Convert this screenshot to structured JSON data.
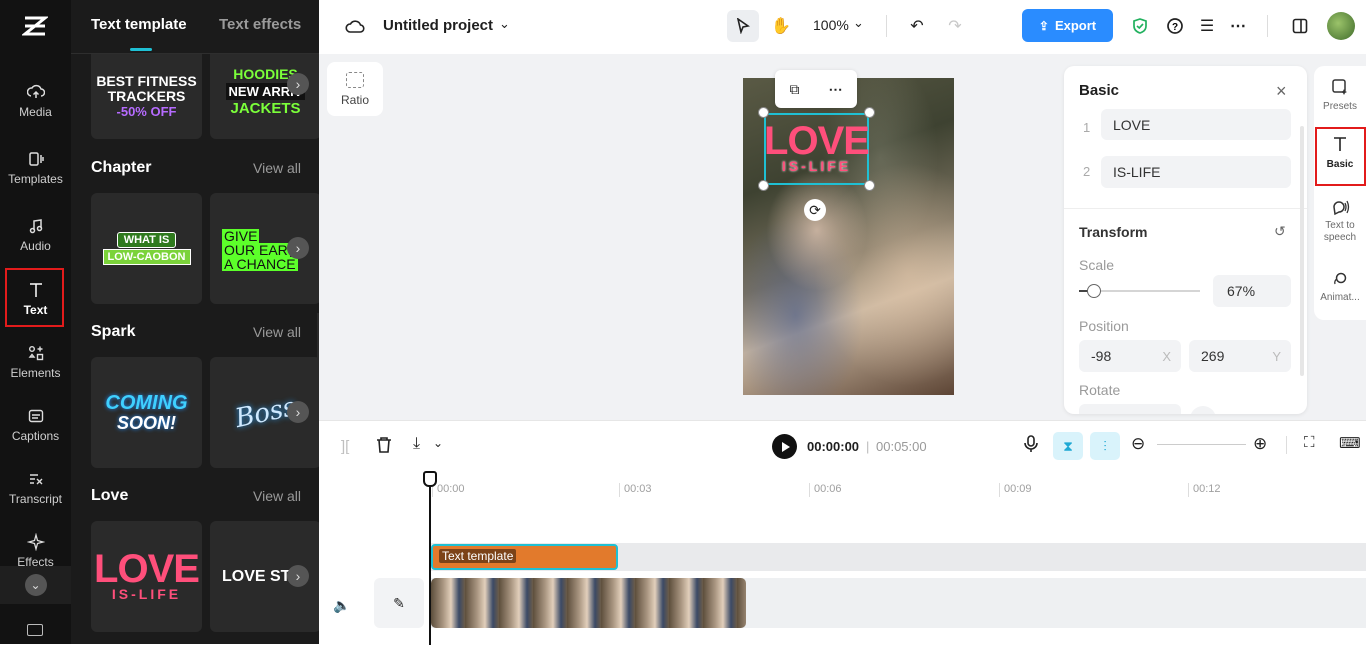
{
  "rail": {
    "items": [
      {
        "label": "Media"
      },
      {
        "label": "Templates"
      },
      {
        "label": "Audio"
      },
      {
        "label": "Text"
      },
      {
        "label": "Elements"
      },
      {
        "label": "Captions"
      },
      {
        "label": "Transcript"
      },
      {
        "label": "Effects"
      }
    ],
    "active": "Text"
  },
  "panel": {
    "tabs": [
      "Text template",
      "Text effects"
    ],
    "view_all": "View all",
    "sections": [
      {
        "title": "Chapter"
      },
      {
        "title": "Spark"
      },
      {
        "title": "Love"
      }
    ],
    "tiles": {
      "fitness": [
        "BEST FITNESS",
        "TRACKERS",
        "-50% OFF"
      ],
      "hoodies": [
        "HOODIES",
        "NEW ARRIV",
        "JACKETS"
      ],
      "chapter1": [
        "WHAT IS",
        "LOW-CAOBON"
      ],
      "chapter2": [
        "GIVE",
        "OUR EAR",
        "A CHANCE"
      ],
      "spark1": [
        "COMING",
        "SOON!"
      ],
      "spark2": "Boss",
      "love1": [
        "LOVE",
        "IS-LIFE"
      ],
      "love2": "LOVE STC"
    }
  },
  "topbar": {
    "project_title": "Untitled project",
    "zoom": "100%",
    "export_label": "Export"
  },
  "canvas": {
    "ratio_label": "Ratio",
    "overlay_text": [
      "LOVE",
      "IS-LIFE"
    ]
  },
  "properties": {
    "title": "Basic",
    "text_rows": [
      {
        "index": "1",
        "value": "LOVE"
      },
      {
        "index": "2",
        "value": "IS-LIFE"
      }
    ],
    "transform_label": "Transform",
    "scale_label": "Scale",
    "scale_value": "67%",
    "scale_fraction": 0.12,
    "position_label": "Position",
    "position_x": "-98",
    "position_x_axis": "X",
    "position_y": "269",
    "position_y_axis": "Y",
    "rotate_label": "Rotate"
  },
  "rightbar": {
    "items": [
      {
        "label": "Presets"
      },
      {
        "label": "Basic"
      },
      {
        "label": "Text to speech"
      },
      {
        "label": "Animat..."
      }
    ]
  },
  "timeline": {
    "current_time": "00:00:00",
    "total_time": "00:05:00",
    "ruler": [
      "00:00",
      "00:03",
      "00:06",
      "00:09",
      "00:12"
    ],
    "text_clip_label": "Text template"
  },
  "colors": {
    "accent": "#2a8cff",
    "highlight": "#e21b1b",
    "clip_orange": "#e27a2c",
    "clip_border": "#1fc0d4",
    "love_pink": "#ff4f7b"
  }
}
